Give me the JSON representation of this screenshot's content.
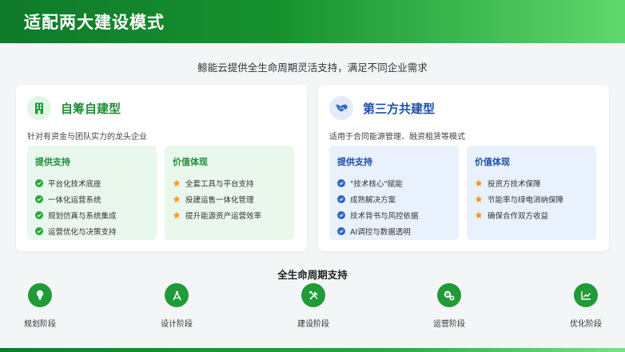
{
  "header": {
    "title": "适配两大建设模式"
  },
  "subtitle": "鲸能云提供全生命周期灵活支持，满足不同企业需求",
  "cards": [
    {
      "icon": "building-icon",
      "title": "自筹自建型",
      "desc": "针对有资金与团队实力的龙头企业",
      "support": {
        "title": "提供支持",
        "items": [
          "平台化技术底座",
          "一体化运营系统",
          "规划仿真与系统集成",
          "运营优化与决策支持"
        ]
      },
      "value": {
        "title": "价值体现",
        "items": [
          "全套工具与平台支持",
          "投建运售一体化管理",
          "提升能源资产运营效率"
        ]
      }
    },
    {
      "icon": "handshake-icon",
      "title": "第三方共建型",
      "desc": "适用于合同能源管理、融资租赁等模式",
      "support": {
        "title": "提供支持",
        "items": [
          "\"技术核心\"赋能",
          "成熟解决方案",
          "技术背书与风控依据",
          "AI调控与数据透明"
        ]
      },
      "value": {
        "title": "价值体现",
        "items": [
          "投资方技术保障",
          "节能率与绿电消纳保障",
          "确保合作双方收益"
        ]
      }
    }
  ],
  "lifecycle": {
    "title": "全生命周期支持",
    "stages": [
      {
        "label": "规划阶段",
        "icon": "lightbulb-icon"
      },
      {
        "label": "设计阶段",
        "icon": "compass-icon"
      },
      {
        "label": "建设阶段",
        "icon": "tools-icon"
      },
      {
        "label": "运营阶段",
        "icon": "gears-icon"
      },
      {
        "label": "优化阶段",
        "icon": "chart-line-icon"
      }
    ]
  },
  "colors": {
    "primary_green": "#1f9b37",
    "primary_blue": "#1f4fa8",
    "star_orange": "#f0a020"
  }
}
